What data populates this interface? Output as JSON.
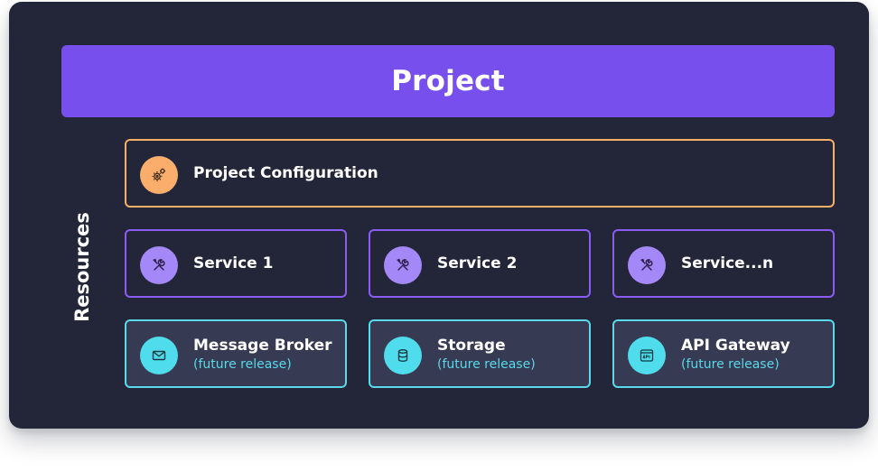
{
  "project": {
    "title": "Project"
  },
  "resources": {
    "label": "Resources"
  },
  "config": {
    "label": "Project Configuration",
    "icon": "gears-icon"
  },
  "services": [
    {
      "label": "Service 1",
      "icon": "tools-icon"
    },
    {
      "label": "Service 2",
      "icon": "tools-icon"
    },
    {
      "label": "Service...n",
      "icon": "tools-icon"
    }
  ],
  "future": [
    {
      "label": "Message Broker",
      "sublabel": "(future release)",
      "icon": "mail-icon"
    },
    {
      "label": "Storage",
      "sublabel": "(future release)",
      "icon": "database-icon"
    },
    {
      "label": "API Gateway",
      "sublabel": "(future release)",
      "icon": "api-window-icon"
    }
  ],
  "colors": {
    "background": "#232639",
    "project": "#774fec",
    "config_border": "#f7ae6a",
    "service_border": "#8a5cf3",
    "future_border": "#5ad9ea"
  }
}
